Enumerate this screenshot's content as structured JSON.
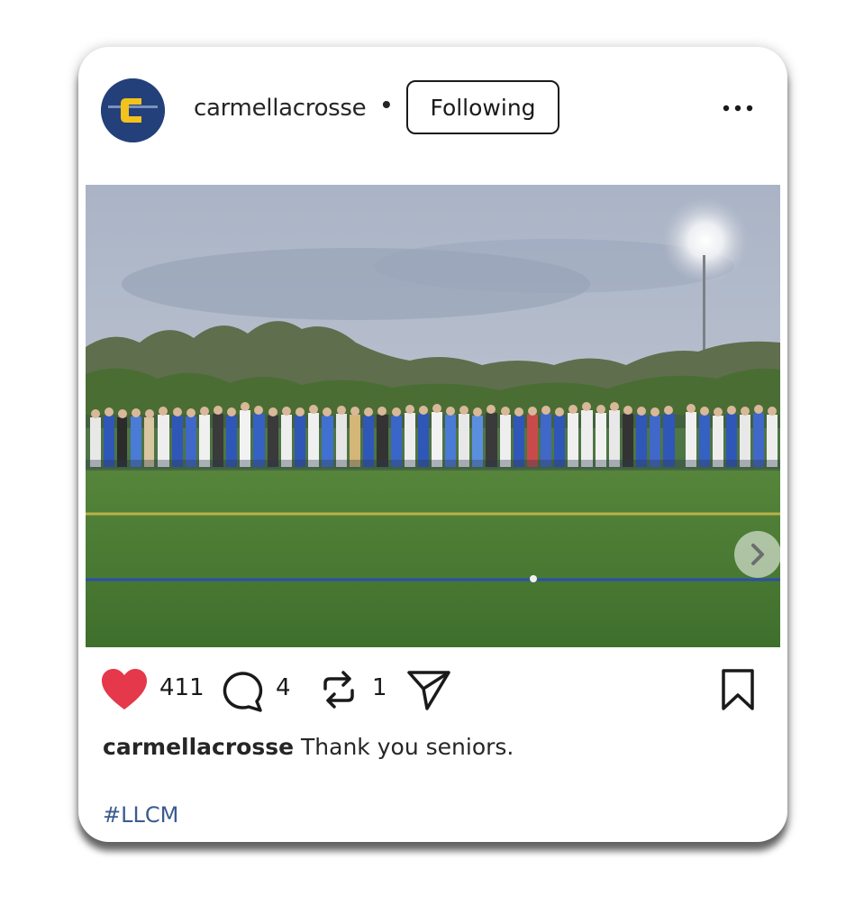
{
  "post": {
    "username": "carmellacrosse",
    "separator": "•",
    "follow_label": "Following",
    "more_icon": "more-dots-icon",
    "avatar_icon": "team-logo-c",
    "photo_description_icon": "team-photo",
    "actions": {
      "likes": "411",
      "comments": "4",
      "reposts": "1"
    },
    "caption": {
      "username": "carmellacrosse",
      "text": "Thank you seniors."
    },
    "hashtag": "#LLCM",
    "colors": {
      "heart": "#e5384a",
      "hashtag": "#3b5b8f",
      "avatar": "#24407a",
      "logo_gold": "#f2c21d"
    }
  }
}
